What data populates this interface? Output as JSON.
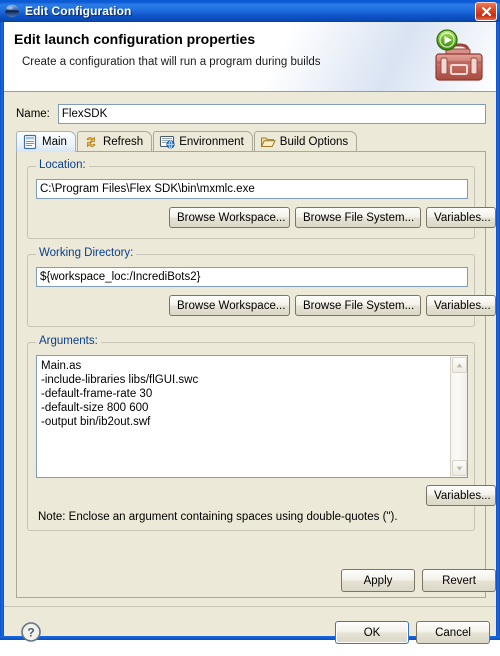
{
  "window": {
    "title": "Edit Configuration",
    "title_icon": "eclipse-sphere-icon",
    "close_label": "×",
    "accent_color": "#0a50c8",
    "client_bg": "#ece9d8"
  },
  "header": {
    "title": "Edit launch configuration properties",
    "subtitle": "Create a configuration that will run a program during builds",
    "icon": "toolbox-run-icon"
  },
  "name": {
    "label": "Name:",
    "value": "FlexSDK",
    "placeholder": ""
  },
  "tabs": [
    {
      "label": "Main",
      "icon": "document-main-icon",
      "active": true
    },
    {
      "label": "Refresh",
      "icon": "refresh-arrows-icon",
      "active": false
    },
    {
      "label": "Environment",
      "icon": "environment-icon",
      "active": false
    },
    {
      "label": "Build Options",
      "icon": "open-folder-icon",
      "active": false
    }
  ],
  "location": {
    "group_label": "Location:",
    "value": "C:\\Program Files\\Flex SDK\\bin\\mxmlc.exe",
    "placeholder": "",
    "buttons": [
      "Browse Workspace...",
      "Browse File System...",
      "Variables..."
    ]
  },
  "working_directory": {
    "group_label": "Working Directory:",
    "value": "${workspace_loc:/IncrediBots2}",
    "placeholder": "",
    "buttons": [
      "Browse Workspace...",
      "Browse File System...",
      "Variables..."
    ]
  },
  "arguments": {
    "group_label": "Arguments:",
    "value": "Main.as\n-include-libraries libs/flGUI.swc\n-default-frame-rate 30\n-default-size 800 600\n-output bin/ib2out.swf",
    "placeholder": "",
    "variables_button": "Variables...",
    "note": "Note: Enclose an argument containing spaces using double-quotes (\")."
  },
  "footer": {
    "apply": "Apply",
    "revert": "Revert",
    "ok": "OK",
    "cancel": "Cancel",
    "help_icon": "help-question-icon"
  }
}
